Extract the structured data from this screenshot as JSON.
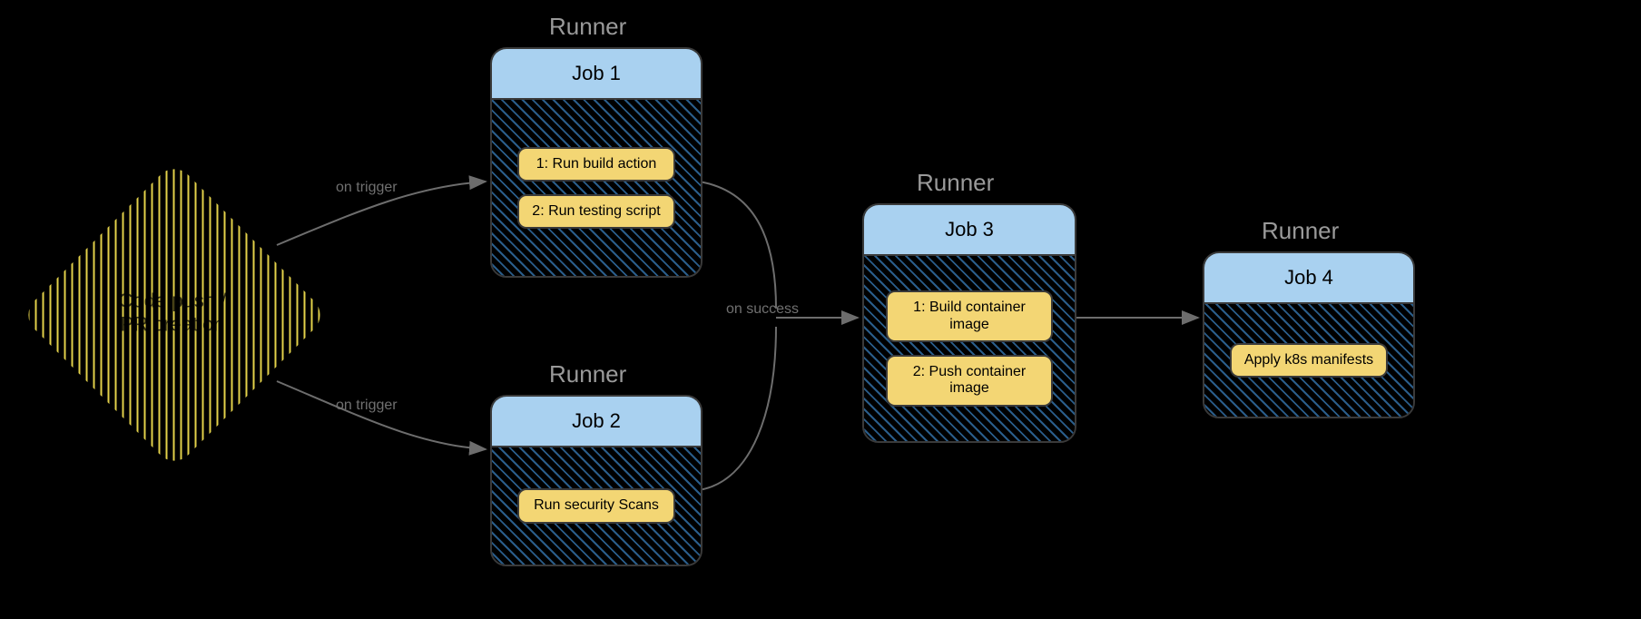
{
  "trigger": {
    "label_line1": "Code push /",
    "label_line2": "PR creation"
  },
  "edges": {
    "trigger_to_job1": "on trigger",
    "trigger_to_job2": "on trigger",
    "jobs_to_job3": "on success"
  },
  "runners": {
    "job1": {
      "runner_label": "Runner",
      "title": "Job 1",
      "steps": [
        "1: Run build action",
        "2: Run testing script"
      ]
    },
    "job2": {
      "runner_label": "Runner",
      "title": "Job 2",
      "steps": [
        "Run security Scans"
      ]
    },
    "job3": {
      "runner_label": "Runner",
      "title": "Job 3",
      "steps": [
        "1: Build container image",
        "2: Push container image"
      ]
    },
    "job4": {
      "runner_label": "Runner",
      "title": "Job 4",
      "steps": [
        "Apply k8s manifests"
      ]
    }
  }
}
